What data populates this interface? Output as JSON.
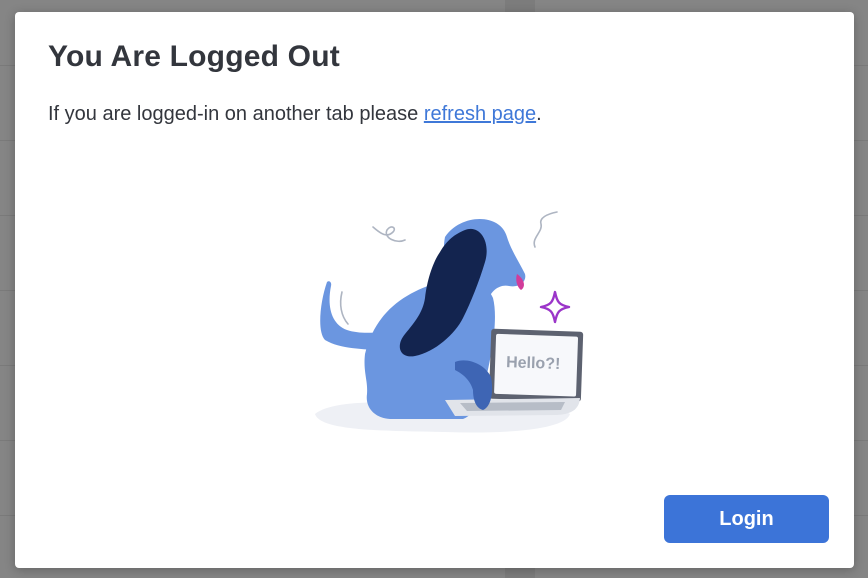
{
  "dialog": {
    "title": "You Are Logged Out",
    "message_prefix": "If you are logged-in on another tab please ",
    "message_link": "refresh page",
    "message_suffix": ".",
    "illustration": {
      "icon": "dog-at-laptop-illustration",
      "screen_text": "Hello?!"
    },
    "login_label": "Login"
  },
  "colors": {
    "backdrop": "#858585",
    "accent": "#3c74d8",
    "link": "#3f78d8",
    "dog_body": "#6b96e0",
    "dog_ear": "#13244f",
    "sparkle": "#9b35c9",
    "nose": "#d13c9a"
  }
}
